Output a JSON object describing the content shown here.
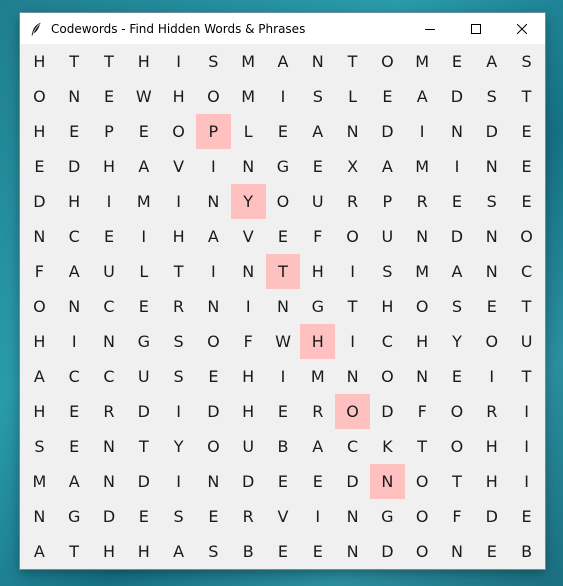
{
  "window": {
    "title": "Codewords - Find Hidden Words & Phrases",
    "icons": {
      "app": "feather-icon",
      "minimize": "minimize-icon",
      "maximize": "maximize-icon",
      "close": "close-icon"
    }
  },
  "grid": {
    "highlight_color": "#ffc0c0",
    "rows": [
      "HTTHISMANTOMEAS",
      "ONEWHOMISLEADST",
      "HEPEOPLEANDINDE",
      "EDHAVINGEXAMINE",
      "DHIMINYOURPRESE",
      "NCEIHAVEFOUNDNO",
      "FAULTINTHISMANC",
      "ONCERNINGTHOSET",
      "HINGSOFWHICHYOU",
      "ACCUSEHIMNONEIT",
      "HERDIDHERODFORI",
      "SENTYOUBACKTOHI",
      "MANDINDEEDNOTHI",
      "NGDESERVINGOFDE",
      "ATHHASBEENDONEB"
    ],
    "highlighted_cells": [
      {
        "row": 2,
        "col": 5,
        "letter": "P"
      },
      {
        "row": 4,
        "col": 6,
        "letter": "Y"
      },
      {
        "row": 6,
        "col": 7,
        "letter": "T"
      },
      {
        "row": 8,
        "col": 8,
        "letter": "H"
      },
      {
        "row": 10,
        "col": 9,
        "letter": "O"
      },
      {
        "row": 12,
        "col": 10,
        "letter": "N"
      }
    ]
  }
}
